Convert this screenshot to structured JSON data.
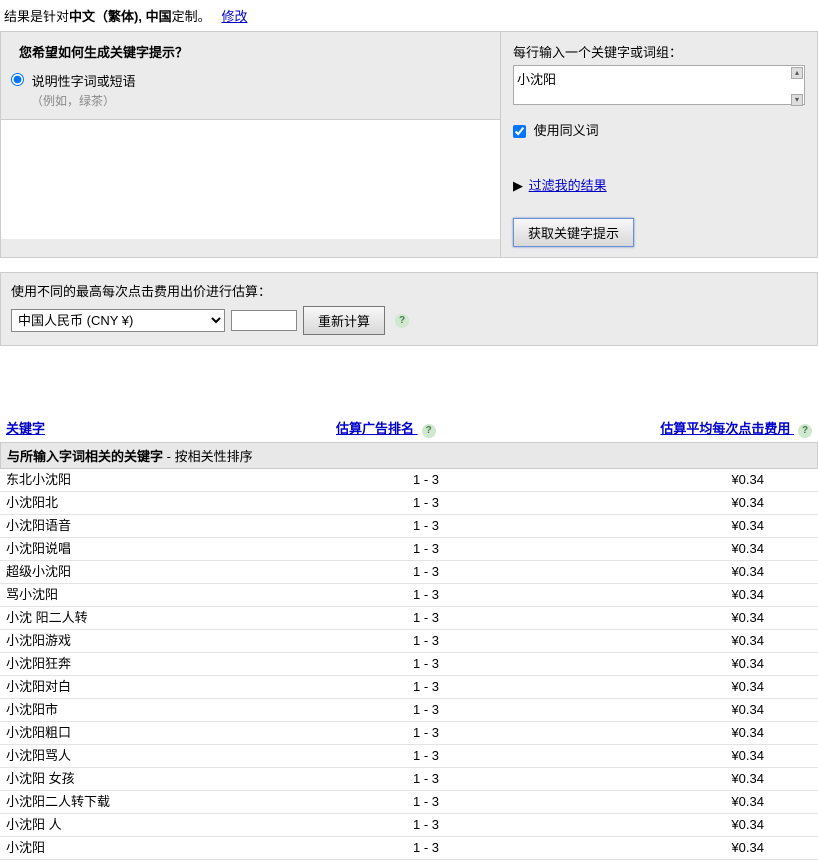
{
  "topNote": {
    "prefix": "结果是针对",
    "locale": "中文（繁体), 中国",
    "suffix": "定制。",
    "changeLink": "修改"
  },
  "leftPanel": {
    "title": "您希望如何生成关键字提示？",
    "optionLabel": "说明性字词或短语",
    "example": "（例如，绿茶）"
  },
  "rightPanel": {
    "inputLabel": "每行输入一个关键字或词组：",
    "textareaValue": "小沈阳",
    "synonymLabel": "使用同义词",
    "filterLink": "过滤我的结果",
    "getButton": "获取关键字提示"
  },
  "budgetPanel": {
    "label": "使用不同的最高每次点击费用出价进行估算：",
    "currency": "中国人民币 (CNY ¥)",
    "recalcButton": "重新计算"
  },
  "tableHeaders": {
    "keyword": "关键字",
    "rank": "估算广告排名",
    "cost": "估算平均每次点击费用"
  },
  "subheader": {
    "bold": "与所输入字词相关的关键字",
    "rest": " - 按相关性排序"
  },
  "rows": [
    {
      "kw": "东北小沈阳",
      "rank": "1 - 3",
      "cost": "¥0.34"
    },
    {
      "kw": "小沈阳北",
      "rank": "1 - 3",
      "cost": "¥0.34"
    },
    {
      "kw": "小沈阳语音",
      "rank": "1 - 3",
      "cost": "¥0.34"
    },
    {
      "kw": "小沈阳说唱",
      "rank": "1 - 3",
      "cost": "¥0.34"
    },
    {
      "kw": "超级小沈阳",
      "rank": "1 - 3",
      "cost": "¥0.34"
    },
    {
      "kw": "骂小沈阳",
      "rank": "1 - 3",
      "cost": "¥0.34"
    },
    {
      "kw": "小沈 阳二人转",
      "rank": "1 - 3",
      "cost": "¥0.34"
    },
    {
      "kw": "小沈阳游戏",
      "rank": "1 - 3",
      "cost": "¥0.34"
    },
    {
      "kw": "小沈阳狂奔",
      "rank": "1 - 3",
      "cost": "¥0.34"
    },
    {
      "kw": "小沈阳对白",
      "rank": "1 - 3",
      "cost": "¥0.34"
    },
    {
      "kw": "小沈阳市",
      "rank": "1 - 3",
      "cost": "¥0.34"
    },
    {
      "kw": "小沈阳粗口",
      "rank": "1 - 3",
      "cost": "¥0.34"
    },
    {
      "kw": "小沈阳骂人",
      "rank": "1 - 3",
      "cost": "¥0.34"
    },
    {
      "kw": "小沈阳 女孩",
      "rank": "1 - 3",
      "cost": "¥0.34"
    },
    {
      "kw": "小沈阳二人转下载",
      "rank": "1 - 3",
      "cost": "¥0.34"
    },
    {
      "kw": "小沈阳 人",
      "rank": "1 - 3",
      "cost": "¥0.34"
    },
    {
      "kw": "小沈阳",
      "rank": "1 - 3",
      "cost": "¥0.34"
    }
  ]
}
